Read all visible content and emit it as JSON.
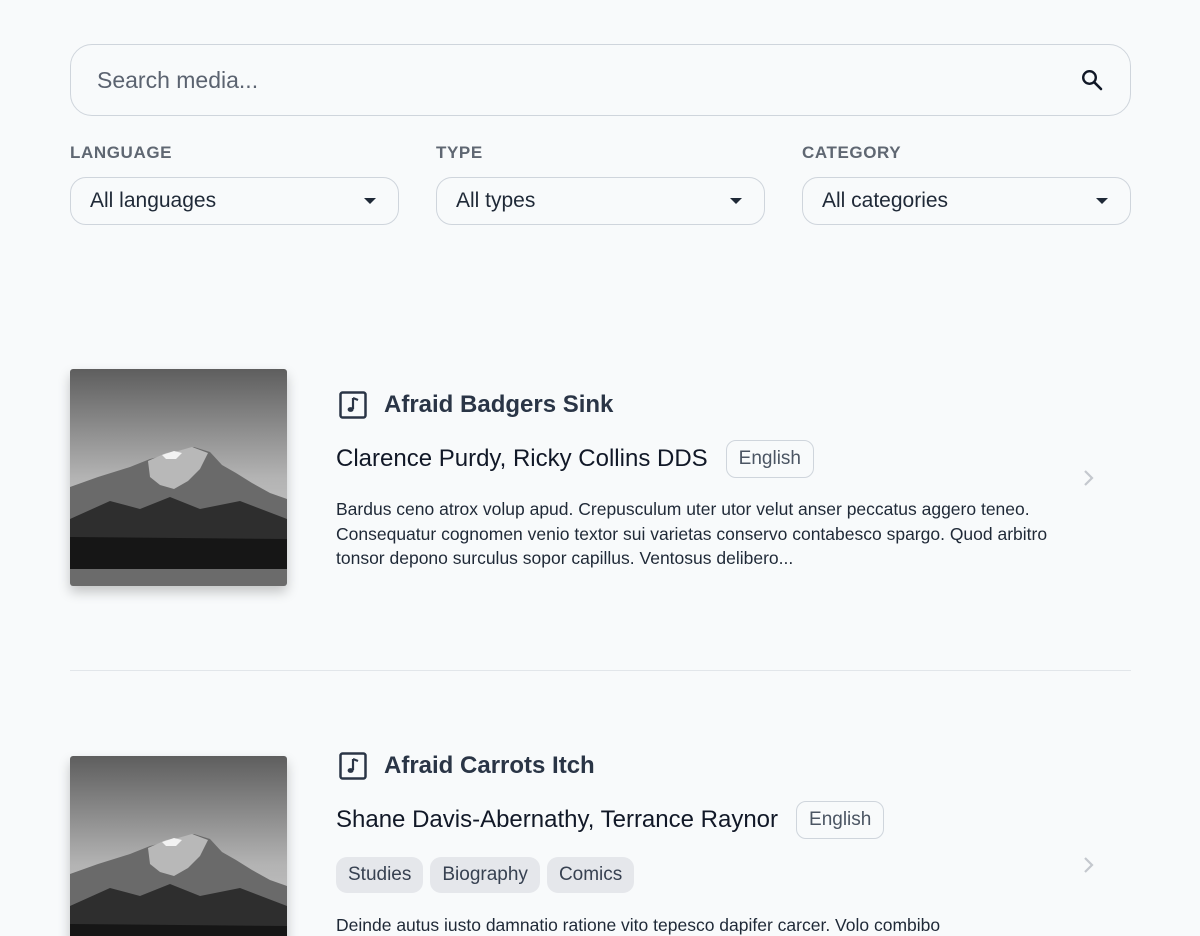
{
  "search": {
    "placeholder": "Search media..."
  },
  "filters": [
    {
      "label": "LANGUAGE",
      "value": "All languages"
    },
    {
      "label": "TYPE",
      "value": "All types"
    },
    {
      "label": "CATEGORY",
      "value": "All categories"
    }
  ],
  "results": [
    {
      "title": "Afraid Badgers Sink",
      "authors": "Clarence Purdy, Ricky Collins DDS",
      "language": "English",
      "type_icon": "music-note-icon",
      "tags": [],
      "description": "Bardus ceno atrox volup apud. Crepusculum uter utor velut anser peccatus aggero teneo. Consequatur cognomen venio textor sui varietas conservo contabesco spargo. Quod arbitro tonsor depono surculus sopor capillus. Ventosus delibero..."
    },
    {
      "title": "Afraid Carrots Itch",
      "authors": "Shane Davis-Abernathy, Terrance Raynor",
      "language": "English",
      "type_icon": "music-note-icon",
      "tags": [
        "Studies",
        "Biography",
        "Comics"
      ],
      "description": "Deinde autus iusto damnatio ratione vito tepesco dapifer carcer. Volo combibo"
    }
  ]
}
